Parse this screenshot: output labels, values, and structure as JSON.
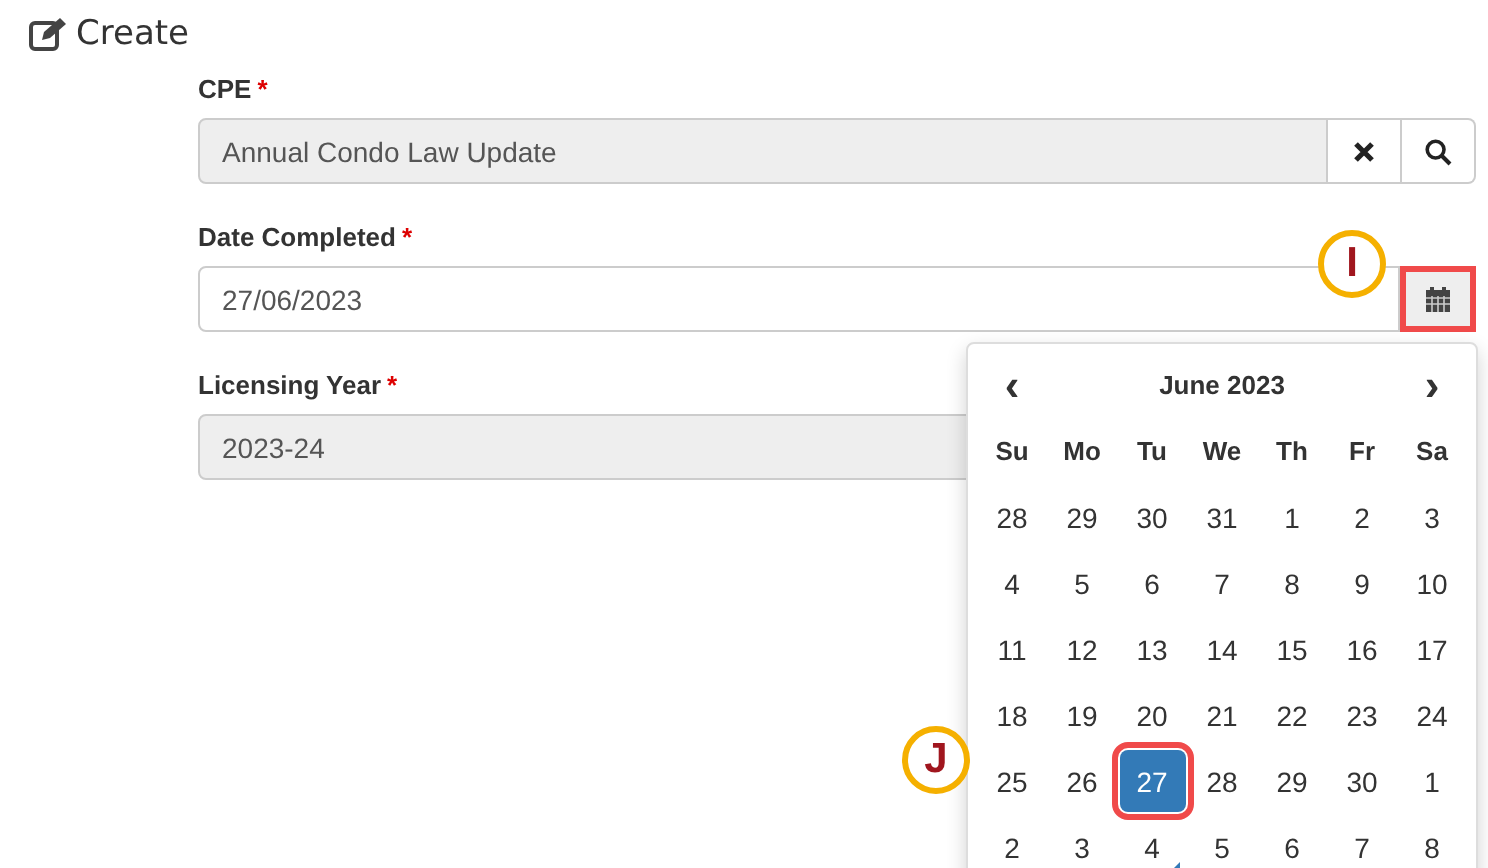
{
  "page_title": "Create",
  "fields": [
    {
      "label": "CPE",
      "required_mark": "*",
      "value": "Annual Condo Law Update",
      "readonly": true,
      "kind": "lookup"
    },
    {
      "label": "Date Completed",
      "required_mark": "*",
      "value": "27/06/2023",
      "readonly": false,
      "kind": "date",
      "button_highlighted": true
    },
    {
      "label": "Licensing Year",
      "required_mark": "*",
      "value": "2023-24",
      "readonly": true,
      "kind": "text"
    }
  ],
  "datepicker": {
    "prev": "‹",
    "title": "June 2023",
    "next": "›",
    "weekdays": [
      "Su",
      "Mo",
      "Tu",
      "We",
      "Th",
      "Fr",
      "Sa"
    ],
    "weeks": [
      [
        {
          "d": "28",
          "selected": false,
          "today": false,
          "highlighted": false
        },
        {
          "d": "29",
          "selected": false,
          "today": false,
          "highlighted": false
        },
        {
          "d": "30",
          "selected": false,
          "today": false,
          "highlighted": false
        },
        {
          "d": "31",
          "selected": false,
          "today": false,
          "highlighted": false
        },
        {
          "d": "1",
          "selected": false,
          "today": false,
          "highlighted": false
        },
        {
          "d": "2",
          "selected": false,
          "today": false,
          "highlighted": false
        },
        {
          "d": "3",
          "selected": false,
          "today": false,
          "highlighted": false
        }
      ],
      [
        {
          "d": "4",
          "selected": false,
          "today": false,
          "highlighted": false
        },
        {
          "d": "5",
          "selected": false,
          "today": false,
          "highlighted": false
        },
        {
          "d": "6",
          "selected": false,
          "today": false,
          "highlighted": false
        },
        {
          "d": "7",
          "selected": false,
          "today": false,
          "highlighted": false
        },
        {
          "d": "8",
          "selected": false,
          "today": false,
          "highlighted": false
        },
        {
          "d": "9",
          "selected": false,
          "today": false,
          "highlighted": false
        },
        {
          "d": "10",
          "selected": false,
          "today": false,
          "highlighted": false
        }
      ],
      [
        {
          "d": "11",
          "selected": false,
          "today": false,
          "highlighted": false
        },
        {
          "d": "12",
          "selected": false,
          "today": false,
          "highlighted": false
        },
        {
          "d": "13",
          "selected": false,
          "today": false,
          "highlighted": false
        },
        {
          "d": "14",
          "selected": false,
          "today": false,
          "highlighted": false
        },
        {
          "d": "15",
          "selected": false,
          "today": false,
          "highlighted": false
        },
        {
          "d": "16",
          "selected": false,
          "today": false,
          "highlighted": false
        },
        {
          "d": "17",
          "selected": false,
          "today": false,
          "highlighted": false
        }
      ],
      [
        {
          "d": "18",
          "selected": false,
          "today": false,
          "highlighted": false
        },
        {
          "d": "19",
          "selected": false,
          "today": false,
          "highlighted": false
        },
        {
          "d": "20",
          "selected": false,
          "today": false,
          "highlighted": false
        },
        {
          "d": "21",
          "selected": false,
          "today": false,
          "highlighted": false
        },
        {
          "d": "22",
          "selected": false,
          "today": false,
          "highlighted": false
        },
        {
          "d": "23",
          "selected": false,
          "today": false,
          "highlighted": false
        },
        {
          "d": "24",
          "selected": false,
          "today": false,
          "highlighted": false
        }
      ],
      [
        {
          "d": "25",
          "selected": false,
          "today": false,
          "highlighted": false
        },
        {
          "d": "26",
          "selected": false,
          "today": false,
          "highlighted": false
        },
        {
          "d": "27",
          "selected": true,
          "today": false,
          "highlighted": true
        },
        {
          "d": "28",
          "selected": false,
          "today": false,
          "highlighted": false
        },
        {
          "d": "29",
          "selected": false,
          "today": false,
          "highlighted": false
        },
        {
          "d": "30",
          "selected": false,
          "today": false,
          "highlighted": false
        },
        {
          "d": "1",
          "selected": false,
          "today": false,
          "highlighted": false
        }
      ],
      [
        {
          "d": "2",
          "selected": false,
          "today": false,
          "highlighted": false
        },
        {
          "d": "3",
          "selected": false,
          "today": false,
          "highlighted": false
        },
        {
          "d": "4",
          "selected": false,
          "today": true,
          "highlighted": false
        },
        {
          "d": "5",
          "selected": false,
          "today": false,
          "highlighted": false
        },
        {
          "d": "6",
          "selected": false,
          "today": false,
          "highlighted": false
        },
        {
          "d": "7",
          "selected": false,
          "today": false,
          "highlighted": false
        },
        {
          "d": "8",
          "selected": false,
          "today": false,
          "highlighted": false
        }
      ]
    ]
  },
  "callouts": [
    {
      "label": "I"
    },
    {
      "label": "J"
    }
  ]
}
